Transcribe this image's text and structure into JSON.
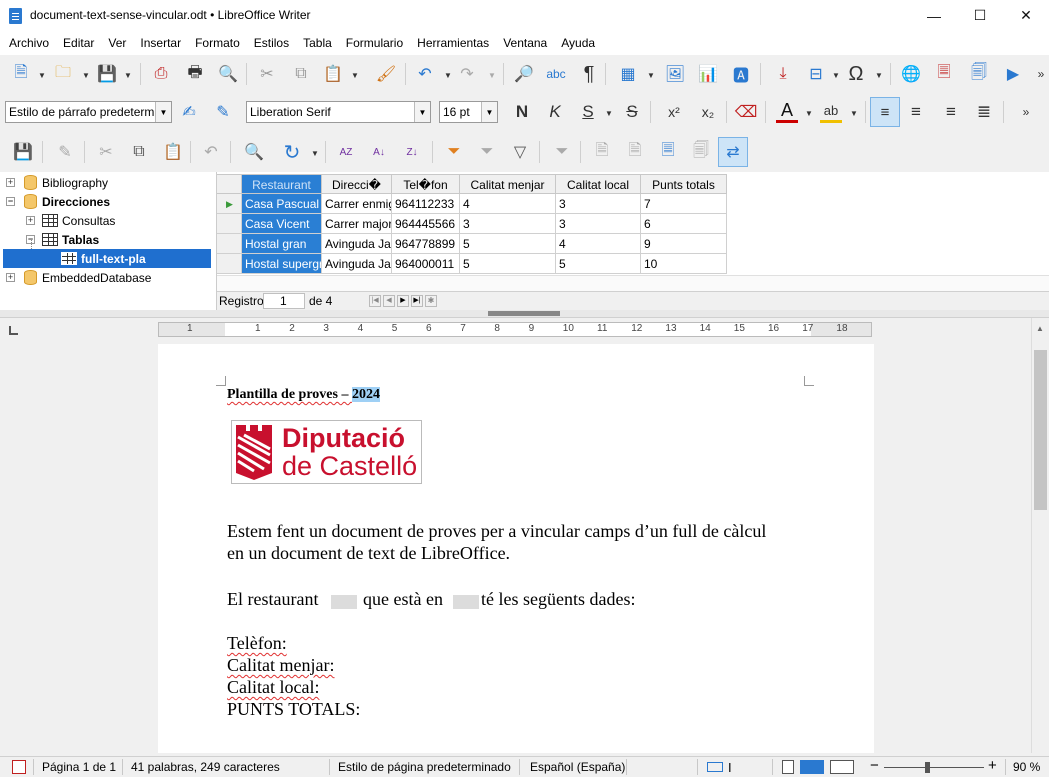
{
  "window": {
    "title": "document-text-sense-vincular.odt • LibreOffice Writer",
    "minimize": "—",
    "maximize": "☐",
    "close": "✕"
  },
  "menu": [
    "Archivo",
    "Editar",
    "Ver",
    "Insertar",
    "Formato",
    "Estilos",
    "Tabla",
    "Formulario",
    "Herramientas",
    "Ventana",
    "Ayuda"
  ],
  "format_toolbar": {
    "paragraph_style": "Estilo de párrafo predetermin",
    "font_name": "Liberation Serif",
    "font_size": "16 pt",
    "bold": "N",
    "italic": "K",
    "underline": "S",
    "strike": "S",
    "superscript": "x²",
    "subscript": "x₂"
  },
  "datasource_tree": {
    "items": [
      {
        "label": "Bibliography",
        "level": 0,
        "expander": "+"
      },
      {
        "label": "Direcciones",
        "level": 0,
        "expander": "−"
      },
      {
        "label": "Consultas",
        "level": 1,
        "expander": "+"
      },
      {
        "label": "Tablas",
        "level": 1,
        "expander": "−"
      },
      {
        "label": "full-text-pla",
        "level": 2,
        "selected": true
      },
      {
        "label": "EmbeddedDatabase",
        "level": 0,
        "expander": "+"
      }
    ]
  },
  "grid": {
    "columns": [
      "Restaurant",
      "Direcci�",
      "Tel�fon",
      "Calitat menjar",
      "Calitat local",
      "Punts totals"
    ],
    "rows": [
      [
        "Casa Pascual",
        "Carrer enmig",
        "964112233",
        "4",
        "3",
        "7"
      ],
      [
        "Casa Vicent",
        "Carrer major",
        "964445566",
        "3",
        "3",
        "6"
      ],
      [
        "Hostal gran",
        "Avinguda Jau",
        "964778899",
        "5",
        "4",
        "9"
      ],
      [
        "Hostal supergr",
        "Avinguda Jau",
        "964000011",
        "5",
        "5",
        "10"
      ]
    ],
    "record_label": "Registro",
    "record_current": "1",
    "record_total": "de 4"
  },
  "ruler": {
    "numbers": [
      "1",
      "1",
      "2",
      "3",
      "4",
      "5",
      "6",
      "7",
      "8",
      "9",
      "10",
      "11",
      "12",
      "13",
      "14",
      "15",
      "16",
      "17",
      "18"
    ]
  },
  "document": {
    "heading_prefix": "Plantilla de proves – ",
    "heading_year": "2024",
    "logo_line1": "Diputació",
    "logo_line2": "de Castelló",
    "logo_color": "#c8102e",
    "para1_line1": "Estem fent un document de proves per a vincular camps d’un full de càlcul",
    "para1_line2": "en un document de text de LibreOffice.",
    "para2_a": "El restaurant",
    "para2_b": "que està en",
    "para2_c": "té les següents dades:",
    "field_telefon": "Telèfon:",
    "field_menjar": "Calitat menjar:",
    "field_local": "Calitat local:",
    "field_total": "PUNTS TOTALS:"
  },
  "status": {
    "page": "Página 1 de 1",
    "words": "41 palabras, 249 caracteres",
    "page_style": "Estilo de página predeterminado",
    "language": "Español (España)",
    "zoom": "90 %"
  },
  "colors": {
    "selection": "#2a7fd4",
    "accent": "#2a79d0"
  }
}
